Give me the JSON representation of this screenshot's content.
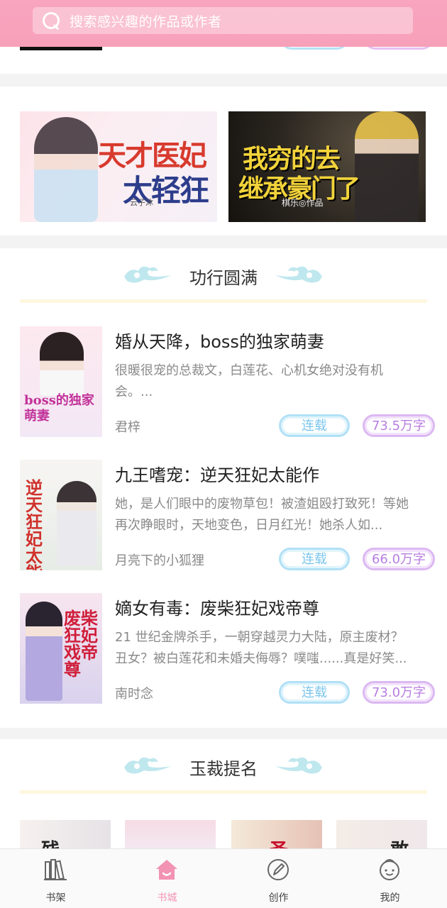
{
  "search": {
    "placeholder": "搜索感兴趣的作品或作者"
  },
  "banners": [
    {
      "title_line1": "天才医妃",
      "title_line2": "太轻狂",
      "author_note": "云子沐"
    },
    {
      "title_line1": "我穷的去",
      "title_line2": "继承豪门了",
      "author_note": "棋乐◎作品"
    }
  ],
  "section1": {
    "title": "功行圆满",
    "books": [
      {
        "title": "婚从天降，boss的独家萌妻",
        "desc": "很暖很宠的总裁文，白莲花、心机女绝对没有机会。...",
        "author": "君梓",
        "status": "连载",
        "words": "73.5万字",
        "cover_text": "boss的独家萌妻"
      },
      {
        "title": "九王嗜宠：逆天狂妃太能作",
        "desc": "她，是人们眼中的废物草包！被渣姐殴打致死！等她再次睁眼时，天地变色，日月红光！她杀人如...",
        "author": "月亮下的小狐狸",
        "status": "连载",
        "words": "66.0万字",
        "cover_text": "逆天狂妃太能作"
      },
      {
        "title": "嫡女有毒：废柴狂妃戏帝尊",
        "desc": "21 世纪金牌杀手，一朝穿越灵力大陆，原主废材？丑女？被白莲花和未婚夫侮辱？噗嗤......真是好笑...",
        "author": "南时念",
        "status": "连载",
        "words": "73.0万字",
        "cover_text": "废柴狂妃戏帝尊"
      }
    ]
  },
  "section2": {
    "title": "玉裁提名",
    "thumb_chars": [
      "残",
      "",
      "圣",
      "敢"
    ]
  },
  "tabs": [
    {
      "label": "书架",
      "icon": "bookshelf-icon"
    },
    {
      "label": "书城",
      "icon": "home-icon",
      "active": true
    },
    {
      "label": "创作",
      "icon": "pen-icon"
    },
    {
      "label": "我的",
      "icon": "profile-icon"
    }
  ],
  "colors": {
    "accent": "#f7a0b9",
    "status_blue": "#7cc6ec",
    "words_purple": "#b87ee0"
  }
}
